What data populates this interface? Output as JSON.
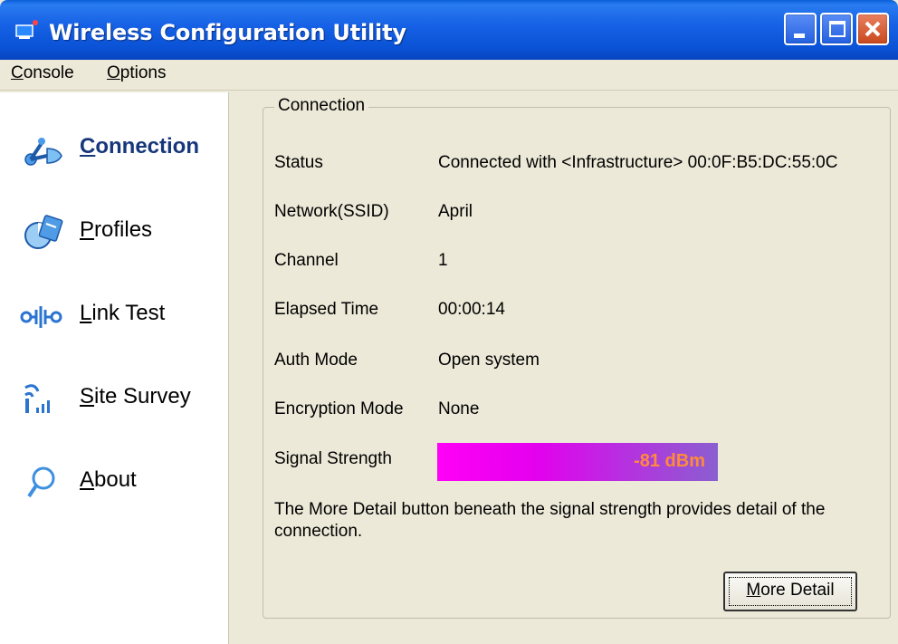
{
  "window": {
    "title": "Wireless Configuration Utility",
    "controls": {
      "minimize": "minimize-icon",
      "maximize": "maximize-icon",
      "close": "close-icon"
    }
  },
  "menu": {
    "console": {
      "first": "C",
      "rest": "onsole"
    },
    "options": {
      "first": "O",
      "rest": "ptions"
    }
  },
  "nav": {
    "items": [
      {
        "key": "connection",
        "first": "C",
        "rest": "onnection",
        "icon": "connection-icon",
        "active": true
      },
      {
        "key": "profiles",
        "first": "P",
        "rest": "rofiles",
        "icon": "profiles-icon",
        "active": false
      },
      {
        "key": "link-test",
        "first": "L",
        "rest": "ink Test",
        "icon": "link-test-icon",
        "active": false
      },
      {
        "key": "site-survey",
        "first": "S",
        "rest": "ite Survey",
        "icon": "site-survey-icon",
        "active": false
      },
      {
        "key": "about",
        "first": "A",
        "rest": "bout",
        "icon": "about-icon",
        "active": false
      }
    ]
  },
  "connection": {
    "group_title": "Connection",
    "rows": [
      {
        "label": "Status",
        "value": "Connected with <Infrastructure> 00:0F:B5:DC:55:0C"
      },
      {
        "label": "Network(SSID)",
        "value": "April"
      },
      {
        "label": "Channel",
        "value": "1"
      },
      {
        "label": "Elapsed Time",
        "value": "00:00:14"
      },
      {
        "label": "Auth Mode",
        "value": "Open system"
      },
      {
        "label": "Encryption Mode",
        "value": "None"
      }
    ],
    "signal": {
      "label": "Signal Strength",
      "value": "-81 dBm"
    },
    "note": "The More Detail button beneath the signal strength provides detail of the connection.",
    "more_detail": {
      "first": "M",
      "rest": "ore Detail"
    }
  },
  "colors": {
    "titlebar": "#0a52d6",
    "signal_start": "#ff00f6",
    "signal_end": "#8a5fd0",
    "signal_text": "#ff8a3d",
    "active_nav": "#16377a"
  }
}
